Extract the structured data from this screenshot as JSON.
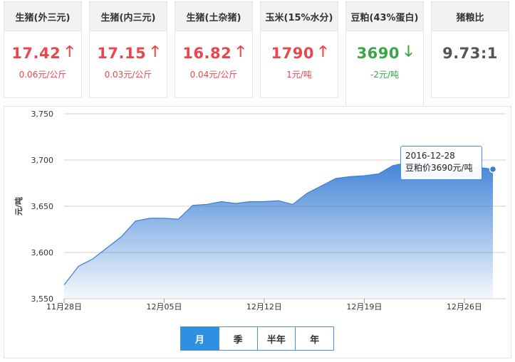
{
  "cards": [
    {
      "title": "生猪(外三元)",
      "price": "17.42",
      "direction": "up",
      "arrow": "🡑",
      "change": "0.06元/公斤"
    },
    {
      "title": "生猪(内三元)",
      "price": "17.15",
      "direction": "up",
      "arrow": "🡑",
      "change": "0.03元/公斤"
    },
    {
      "title": "生猪(土杂猪)",
      "price": "16.82",
      "direction": "up",
      "arrow": "🡑",
      "change": "0.04元/公斤"
    },
    {
      "title": "玉米(15%水分)",
      "price": "1790",
      "direction": "up",
      "arrow": "🡑",
      "change": "1元/吨"
    },
    {
      "title": "豆粕(43%蛋白)",
      "price": "3690",
      "direction": "down",
      "arrow": "🡓",
      "change": "-2元/吨"
    },
    {
      "title": "猪粮比",
      "price": "9.73:1",
      "direction": "neutral",
      "arrow": "",
      "change": ""
    }
  ],
  "active_card_index": 4,
  "colors": {
    "up": "#e8474d",
    "down": "#3aa64a",
    "accent": "#2f8fe0",
    "series": "#3a7fd5"
  },
  "tooltip": {
    "date": "2016-12-28",
    "text": "豆粕价3690元/吨"
  },
  "range_tabs": [
    {
      "label": "月",
      "active": true
    },
    {
      "label": "季",
      "active": false
    },
    {
      "label": "半年",
      "active": false
    },
    {
      "label": "年",
      "active": false
    }
  ],
  "chart_data": {
    "type": "area",
    "title": "",
    "xlabel": "",
    "ylabel": "元/吨",
    "ylim": [
      3550,
      3750
    ],
    "yticks": [
      3550,
      3600,
      3650,
      3700,
      3750
    ],
    "ytick_labels": [
      "3,550",
      "3,600",
      "3,650",
      "3,700",
      "3,750"
    ],
    "xlim": [
      "2016-11-28",
      "2016-12-28"
    ],
    "xticks": [
      "2016-11-28",
      "2016-12-05",
      "2016-12-12",
      "2016-12-19",
      "2016-12-26"
    ],
    "xtick_labels": [
      "11月28日",
      "12月05日",
      "12月12日",
      "12月19日",
      "12月26日"
    ],
    "grid": true,
    "legend": "none",
    "series": [
      {
        "x": [
          "2016-11-28",
          "2016-11-29",
          "2016-11-30",
          "2016-12-01",
          "2016-12-02",
          "2016-12-03",
          "2016-12-04",
          "2016-12-05",
          "2016-12-06",
          "2016-12-07",
          "2016-12-08",
          "2016-12-09",
          "2016-12-10",
          "2016-12-11",
          "2016-12-12",
          "2016-12-13",
          "2016-12-14",
          "2016-12-15",
          "2016-12-16",
          "2016-12-17",
          "2016-12-18",
          "2016-12-19",
          "2016-12-20",
          "2016-12-21",
          "2016-12-22",
          "2016-12-23",
          "2016-12-24",
          "2016-12-25",
          "2016-12-26",
          "2016-12-27",
          "2016-12-28"
        ],
        "values": [
          3565,
          3585,
          3593,
          3605,
          3617,
          3634,
          3637,
          3637,
          3636,
          3651,
          3652,
          3655,
          3653,
          3655,
          3655,
          3656,
          3652,
          3664,
          3672,
          3680,
          3682,
          3683,
          3685,
          3694,
          3697,
          3697,
          3696,
          3694,
          3692,
          3692,
          3690
        ]
      }
    ]
  }
}
